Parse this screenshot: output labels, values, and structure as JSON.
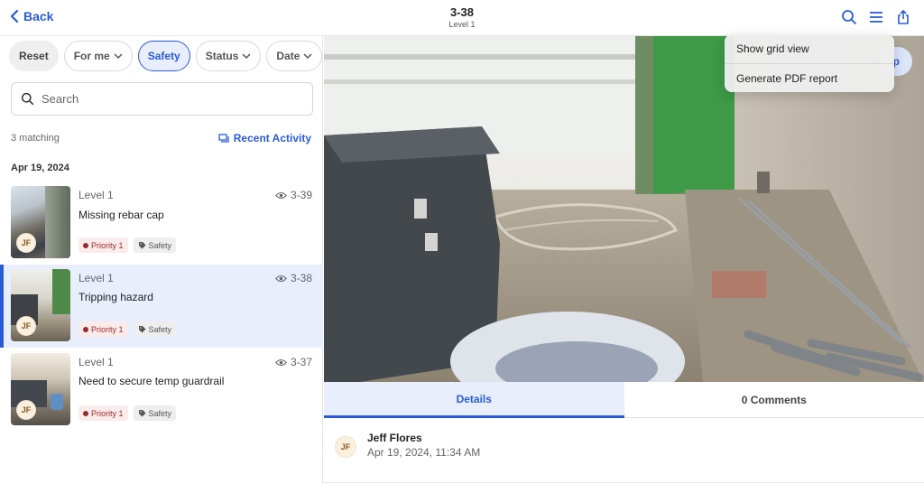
{
  "header": {
    "back_label": "Back",
    "title": "3-38",
    "subtitle": "Level 1"
  },
  "filters": {
    "reset": "Reset",
    "for_me": "For me",
    "safety": "Safety",
    "status": "Status",
    "date": "Date"
  },
  "search": {
    "placeholder": "Search"
  },
  "list": {
    "matching": "3 matching",
    "recent_activity": "Recent Activity",
    "date_header": "Apr 19, 2024",
    "items": [
      {
        "level": "Level 1",
        "number": "3-39",
        "title": "Missing rebar cap",
        "priority": "Priority 1",
        "category": "Safety",
        "avatar": "JF"
      },
      {
        "level": "Level 1",
        "number": "3-38",
        "title": "Tripping hazard",
        "priority": "Priority 1",
        "category": "Safety",
        "avatar": "JF"
      },
      {
        "level": "Level 1",
        "number": "3-37",
        "title": "Need to secure temp guardrail",
        "priority": "Priority 1",
        "category": "Safety",
        "avatar": "JF"
      }
    ]
  },
  "menu": {
    "items": [
      "Show grid view",
      "Generate PDF report"
    ]
  },
  "partial_button": "p",
  "tabs": {
    "details": "Details",
    "comments": "0 Comments"
  },
  "detail": {
    "avatar": "JF",
    "name": "Jeff Flores",
    "date": "Apr 19, 2024, 11:34 AM"
  },
  "colors": {
    "accent": "#2a5bd7",
    "selected_bg": "#e8eefc",
    "priority": "#9b2a2a"
  }
}
